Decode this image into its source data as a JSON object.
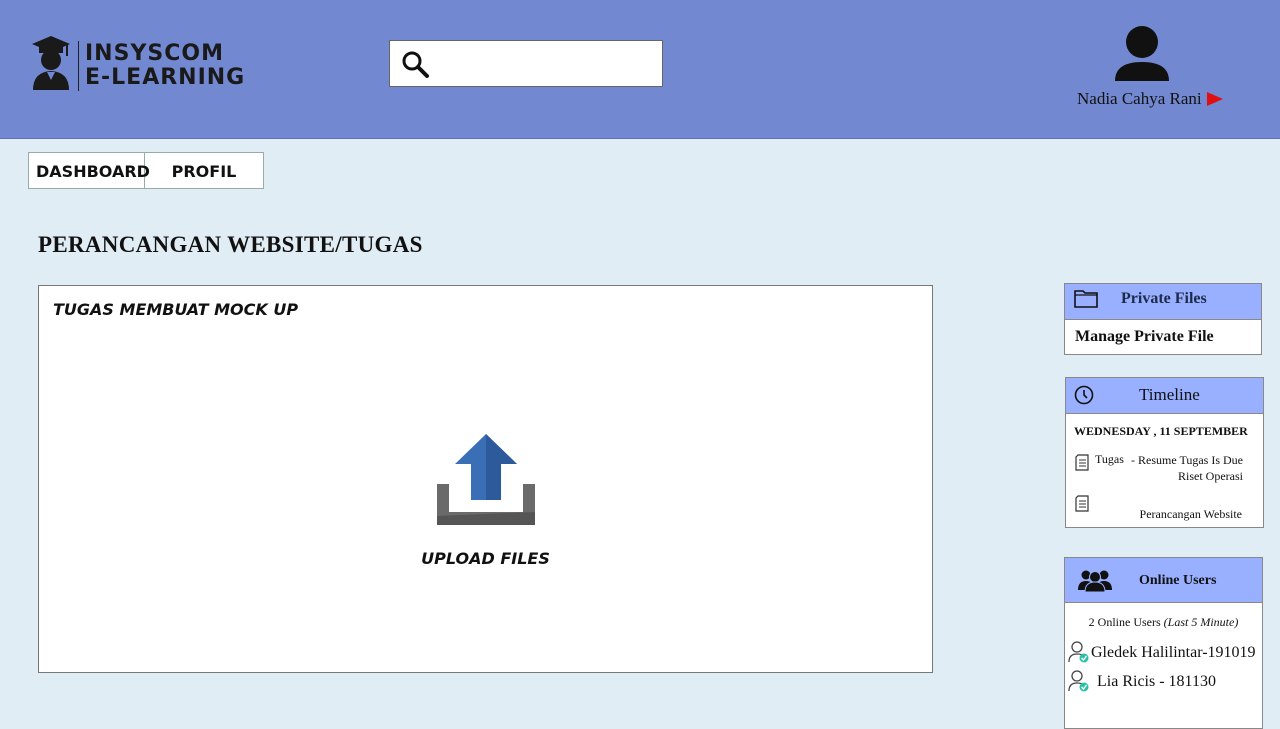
{
  "header": {
    "logo": {
      "line1": "INSYSCOM",
      "line2": "E-LEARNING"
    },
    "search": {
      "placeholder": ""
    },
    "user": {
      "name": "Nadia Cahya Rani"
    }
  },
  "tabs": [
    {
      "label": "DASHBOARD"
    },
    {
      "label": "PROFIL"
    }
  ],
  "page": {
    "title": "PERANCANGAN WEBSITE/TUGAS"
  },
  "main": {
    "task_title": "TUGAS MEMBUAT MOCK UP",
    "upload_label": "UPLOAD FILES"
  },
  "private_files": {
    "title": "Private Files",
    "link": "Manage Private File"
  },
  "timeline": {
    "title": "Timeline",
    "date": "WEDNESDAY , 11 SEPTEMBER",
    "events": [
      {
        "name": "Tugas",
        "desc": "- Resume Tugas Is Due Riset Operasi"
      },
      {
        "name": "",
        "desc": "Perancangan Website"
      }
    ]
  },
  "online_users": {
    "title": "Online Users",
    "count_text": "2 Online Users",
    "count_note": "(Last 5 Minute)",
    "users": [
      {
        "name": "Gledek Halilintar-191019"
      },
      {
        "name": "Lia Ricis - 181130"
      }
    ]
  },
  "colors": {
    "header_bg": "#7289d2",
    "page_bg": "#e0edf5",
    "card_header": "#98b0ff",
    "upload_arrow": "#3a6fb5",
    "user_menu_arrow": "#e01010",
    "online_check": "#2bbfa4"
  }
}
